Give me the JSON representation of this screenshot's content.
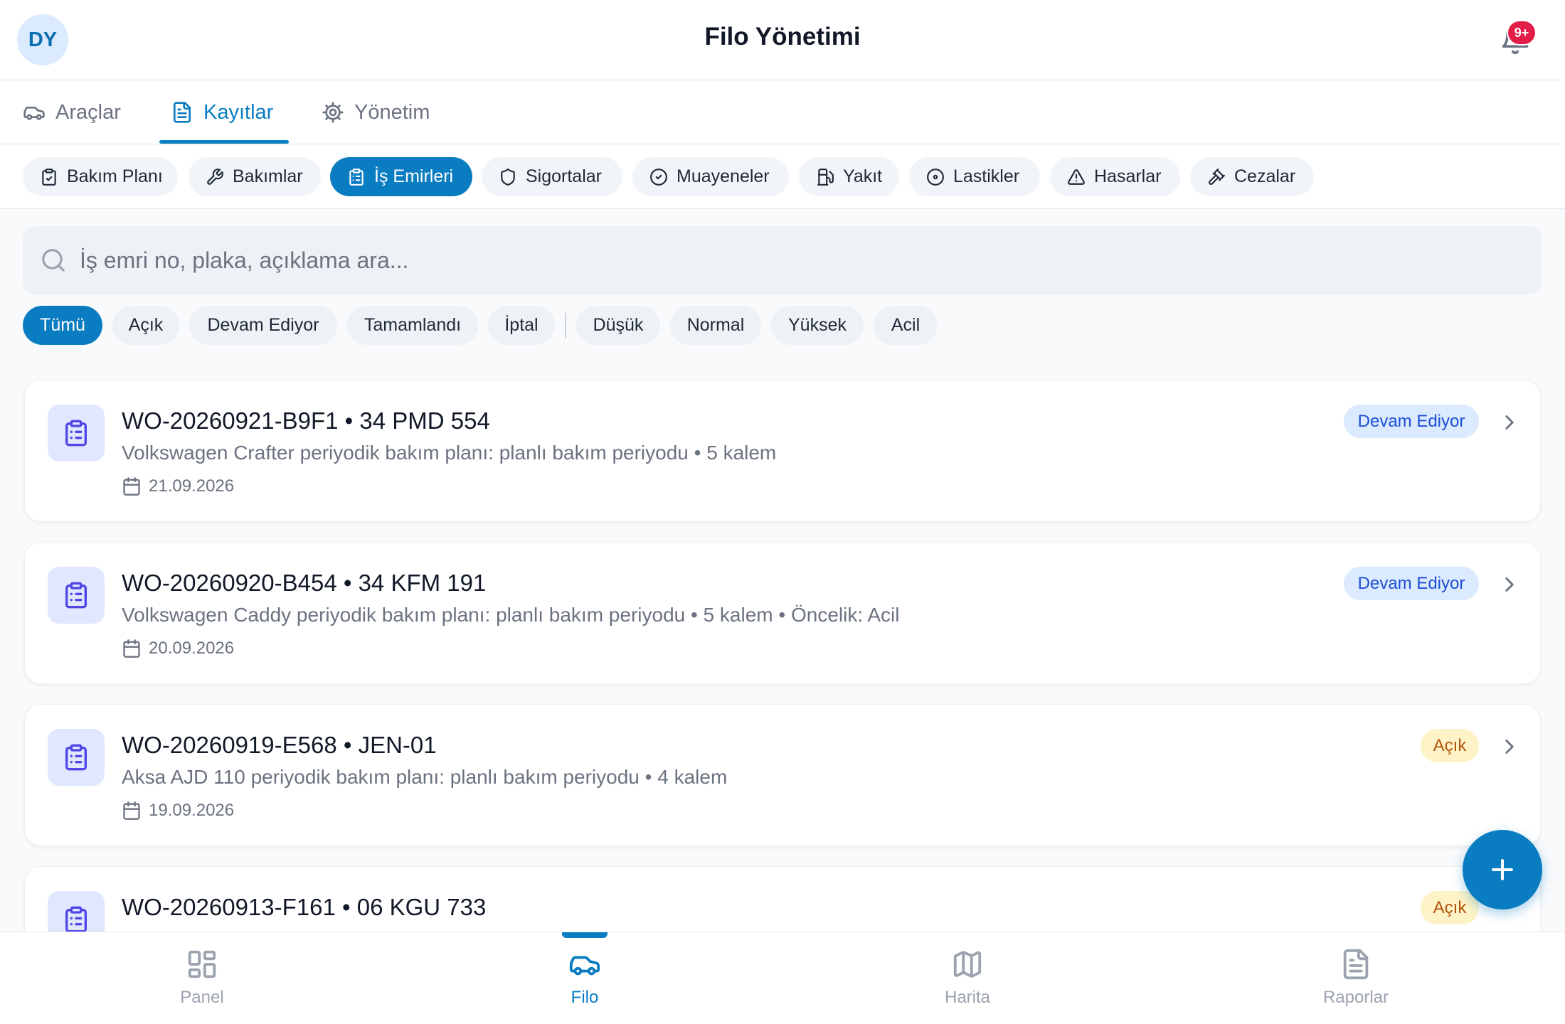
{
  "header": {
    "avatar_initials": "DY",
    "title": "Filo Yönetimi",
    "notification_count": "9+"
  },
  "tabs": [
    {
      "label": "Araçlar",
      "icon": "car-icon",
      "active": false
    },
    {
      "label": "Kayıtlar",
      "icon": "document-icon",
      "active": true
    },
    {
      "label": "Yönetim",
      "icon": "gear-icon",
      "active": false
    }
  ],
  "categories": [
    {
      "label": "Bakım Planı",
      "icon": "clipboard-check-icon",
      "active": false
    },
    {
      "label": "Bakımlar",
      "icon": "wrench-icon",
      "active": false
    },
    {
      "label": "İş Emirleri",
      "icon": "clipboard-list-icon",
      "active": true
    },
    {
      "label": "Sigortalar",
      "icon": "shield-icon",
      "active": false
    },
    {
      "label": "Muayeneler",
      "icon": "check-circle-icon",
      "active": false
    },
    {
      "label": "Yakıt",
      "icon": "fuel-icon",
      "active": false
    },
    {
      "label": "Lastikler",
      "icon": "tire-icon",
      "active": false
    },
    {
      "label": "Hasarlar",
      "icon": "warning-icon",
      "active": false
    },
    {
      "label": "Cezalar",
      "icon": "gavel-icon",
      "active": false
    }
  ],
  "search": {
    "placeholder": "İş emri no, plaka, açıklama ara...",
    "value": ""
  },
  "filters": {
    "status": [
      {
        "label": "Tümü",
        "active": true
      },
      {
        "label": "Açık",
        "active": false
      },
      {
        "label": "Devam Ediyor",
        "active": false
      },
      {
        "label": "Tamamlandı",
        "active": false
      },
      {
        "label": "İptal",
        "active": false
      }
    ],
    "priority": [
      {
        "label": "Düşük",
        "active": false
      },
      {
        "label": "Normal",
        "active": false
      },
      {
        "label": "Yüksek",
        "active": false
      },
      {
        "label": "Acil",
        "active": false
      }
    ]
  },
  "work_orders": [
    {
      "title": "WO-20260921-B9F1 • 34 PMD 554",
      "description": "Volkswagen Crafter periyodik bakım planı: planlı bakım periyodu • 5 kalem",
      "date": "21.09.2026",
      "status": "Devam Ediyor",
      "status_color": "#dbeafe"
    },
    {
      "title": "WO-20260920-B454 • 34 KFM 191",
      "description": "Volkswagen Caddy periyodik bakım planı: planlı bakım periyodu • 5 kalem • Öncelik: Acil",
      "date": "20.09.2026",
      "status": "Devam Ediyor",
      "status_color": "#dbeafe"
    },
    {
      "title": "WO-20260919-E568 • JEN-01",
      "description": "Aksa AJD 110 periyodik bakım planı: planlı bakım periyodu • 4 kalem",
      "date": "19.09.2026",
      "status": "Açık",
      "status_color": "#fef3c7"
    },
    {
      "title": "WO-20260913-F161 • 06 KGU 733",
      "description": "",
      "date": "",
      "status": "Açık",
      "status_color": "#fef3c7"
    }
  ],
  "bottom_nav": [
    {
      "label": "Panel",
      "icon": "grid-icon",
      "active": false
    },
    {
      "label": "Filo",
      "icon": "car-icon",
      "active": true
    },
    {
      "label": "Harita",
      "icon": "map-icon",
      "active": false
    },
    {
      "label": "Raporlar",
      "icon": "report-icon",
      "active": false
    }
  ],
  "colors": {
    "accent": "#0a7cc1",
    "badge": "#e11d48"
  }
}
